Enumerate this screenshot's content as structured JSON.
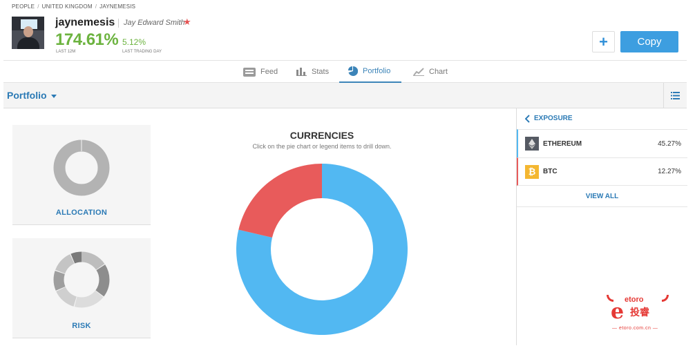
{
  "breadcrumb": [
    "PEOPLE",
    "UNITED KINGDOM",
    "JAYNEMESIS"
  ],
  "profile": {
    "username": "jaynemesis",
    "full_name": "Jay Edward Smith",
    "gain_12m": "174.61%",
    "gain_12m_label": "LAST 12M",
    "gain_day": "5.12%",
    "gain_day_label": "LAST TRADING DAY"
  },
  "actions": {
    "plus_label": "+",
    "copy_label": "Copy"
  },
  "tabs": [
    {
      "label": "Feed",
      "icon": "feed-icon"
    },
    {
      "label": "Stats",
      "icon": "stats-icon"
    },
    {
      "label": "Portfolio",
      "icon": "pie-chart-icon",
      "active": true
    },
    {
      "label": "Chart",
      "icon": "line-chart-icon"
    }
  ],
  "portfolio_header": {
    "title": "Portfolio"
  },
  "cards": {
    "allocation": "ALLOCATION",
    "risk": "RISK"
  },
  "chart_data": {
    "type": "pie",
    "title": "CURRENCIES",
    "subtitle": "Click on the pie chart or legend items to drill down.",
    "slices": [
      {
        "name": "ETHEREUM",
        "value": 78.68,
        "color": "#52b8f2"
      },
      {
        "name": "BTC",
        "value": 21.32,
        "color": "#e85b5b"
      }
    ]
  },
  "exposure": {
    "title": "EXPOSURE",
    "items": [
      {
        "name": "ETHEREUM",
        "value": "45.27%",
        "color": "#52b8f2"
      },
      {
        "name": "BTC",
        "value": "12.27%",
        "color": "#e85b5b"
      }
    ],
    "view_all": "VIEW ALL"
  },
  "watermark": {
    "brand": "etoro",
    "cn": "投睿",
    "url": "— etoro.com.cn —"
  }
}
